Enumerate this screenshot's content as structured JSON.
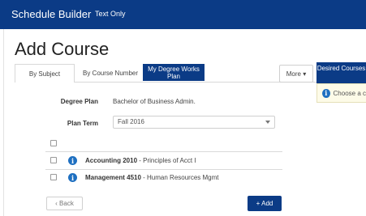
{
  "header": {
    "app_title": "Schedule Builder",
    "text_only_link": "Text Only"
  },
  "page": {
    "title": "Add Course"
  },
  "tabs": [
    {
      "label": "By Subject",
      "active": false
    },
    {
      "label": "By Course Number",
      "active": false
    },
    {
      "label": "My Degree Works Plan",
      "active": true
    }
  ],
  "more_menu": {
    "label": "More ▾"
  },
  "desired_courses": {
    "label": "Desired Courses",
    "hint": "Choose a c"
  },
  "form": {
    "degree_plan_label": "Degree Plan",
    "degree_plan_value": "Bachelor of Business Admin.",
    "plan_term_label": "Plan Term",
    "plan_term_value": "Fall 2016"
  },
  "courses": [
    {
      "code": "Accounting 2010",
      "title": " - Principles of Acct I"
    },
    {
      "code": "Management 4510",
      "title": " - Human Resources Mgmt"
    }
  ],
  "buttons": {
    "back": "‹ Back",
    "add": "+ Add"
  },
  "colors": {
    "brand": "#0b3b86",
    "info": "#1f70c1"
  }
}
